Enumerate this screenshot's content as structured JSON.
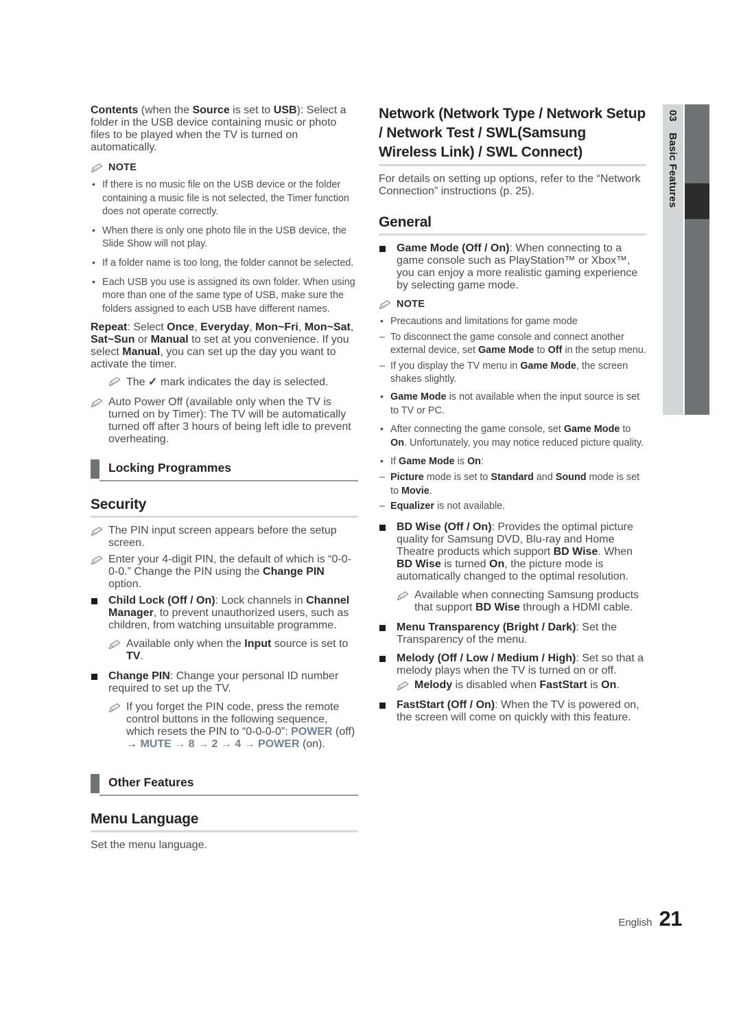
{
  "side_tab": {
    "chapter_number": "03",
    "chapter_label": "Basic Features"
  },
  "footer": {
    "language": "English",
    "page_number": "21"
  },
  "left_column": {
    "contents_paragraph": {
      "lead": "Contents",
      "rest": " (when the ",
      "b1": "Source",
      "mid": " is set to ",
      "b2": "USB",
      "tail": "): Select a folder in the USB device containing music or photo files to be played when the TV is turned on automatically."
    },
    "note_label": "NOTE",
    "note_bullets": [
      "If there is no music file on the USB device or the folder containing a music file is not selected, the Timer function does not operate correctly.",
      "When there is only one photo file in the USB device, the Slide Show will not play.",
      "If a folder name is too long, the folder cannot be selected.",
      "Each USB you use is assigned its own folder. When using more than one of the same type of USB, make sure the folders assigned to each USB have different names."
    ],
    "repeat_paragraph": {
      "lead": "Repeat",
      "t1": ": Select ",
      "b1": "Once",
      "t2": ", ",
      "b2": "Everyday",
      "t3": ", ",
      "b3": "Mon~Fri",
      "t4": ", ",
      "b4": "Mon~Sat",
      "t5": ", ",
      "b5": "Sat~Sun",
      "t6": " or ",
      "b6": "Manual",
      "t7": " to set at you convenience. If you select ",
      "b7": "Manual",
      "t8": ", you can set up the day you want to activate the timer."
    },
    "repeat_note": {
      "pre": "The ",
      "mark": "✓",
      "post": " mark indicates the day is selected."
    },
    "auto_power_note": "Auto Power Off (available only when the TV is turned on by Timer): The TV will be automatically turned off after 3 hours of being left idle to prevent overheating.",
    "section_locking": "Locking Programmes",
    "heading_security": "Security",
    "security_note_1": "The PIN input screen appears before the setup screen.",
    "security_note_2": {
      "t1": "Enter your 4-digit PIN, the default of which is “0-0-0-0.” Change the PIN using the ",
      "b1": "Change PIN",
      "t2": " option."
    },
    "child_lock": {
      "lead": "Child Lock (Off / On)",
      "t1": ": Lock channels in ",
      "b1": "Channel Manager",
      "t2": ", to prevent unauthorized users, such as children, from watching unsuitable programme."
    },
    "child_lock_note": {
      "t1": "Available only when the ",
      "b1": "Input",
      "t2": " source is set to ",
      "b2": "TV",
      "t3": "."
    },
    "change_pin": {
      "lead": "Change PIN",
      "t1": ": Change your personal ID number required to set up the TV."
    },
    "change_pin_note": {
      "t1": "If you forget the PIN code, press the remote control buttons in the following sequence, which resets the PIN to “0-0-0-0”: ",
      "k1": "POWER",
      "t2": " (off) → ",
      "k2": "MUTE",
      "t3": " → 8 → 2 → 4 → ",
      "k3": "POWER",
      "t4": " (on)."
    },
    "section_other_features": "Other Features",
    "heading_menu_language": "Menu Language",
    "menu_language_text": "Set the menu language."
  },
  "right_column": {
    "heading_network": "Network (Network Type / Network Setup / Network Test  / SWL(Samsung Wireless Link) / SWL Connect)",
    "network_text": "For details on setting up options, refer to the “Network Connection” instructions (p. 25).",
    "heading_general": "General",
    "game_mode": {
      "lead": "Game Mode (Off / On)",
      "t1": ": When connecting to a game console such as PlayStation™ or Xbox™, you can enjoy a more realistic gaming experience by selecting game mode."
    },
    "note_label": "NOTE",
    "note_bullet_1": "Precautions and limitations for game mode",
    "note_dashes": [
      {
        "t1": "To disconnect the game console and connect another external device, set ",
        "b1": "Game Mode",
        "t2": " to ",
        "b2": "Off",
        "t3": " in the setup menu."
      },
      {
        "t1": "If you display the TV menu in ",
        "b1": "Game Mode",
        "t2": ", the screen shakes slightly.",
        "b2": "",
        "t3": ""
      }
    ],
    "note_bullet_2": {
      "b1": "Game Mode",
      "t1": " is not available when the input source is set to TV or PC."
    },
    "note_bullet_3": {
      "t1": "After connecting the game console, set ",
      "b1": "Game Mode",
      "t2": " to ",
      "b2": "On",
      "t3": ". Unfortunately, you may notice reduced picture quality."
    },
    "note_bullet_4": {
      "t1": "If ",
      "b1": "Game Mode",
      "t2": " is ",
      "b2": "On",
      "t3": ":"
    },
    "note_bullet_4_dashes": [
      {
        "b1": "Picture",
        "t1": " mode is set to ",
        "b2": "Standard",
        "t2": " and ",
        "b3": "Sound",
        "t3": " mode is set to ",
        "b4": "Movie",
        "t4": "."
      },
      {
        "b1": "Equalizer",
        "t1": " is not available.",
        "b2": "",
        "t2": "",
        "b3": "",
        "t3": "",
        "b4": "",
        "t4": ""
      }
    ],
    "bd_wise": {
      "lead": "BD Wise (Off / On)",
      "t1": ": Provides the optimal picture quality for Samsung DVD, Blu-ray and Home Theatre products which support ",
      "b1": "BD Wise",
      "t2": ". When ",
      "b2": "BD Wise",
      "t3": " is turned ",
      "b3": "On",
      "t4": ", the picture mode is automatically changed to the optimal resolution."
    },
    "bd_wise_note": {
      "t1": "Available when connecting Samsung products that support ",
      "b1": "BD Wise",
      "t2": " through a HDMI cable."
    },
    "menu_transparency": {
      "lead": "Menu Transparency (Bright / Dark)",
      "t1": ": Set the Transparency of the menu."
    },
    "melody": {
      "lead": "Melody (Off / Low / Medium / High)",
      "t1": ": Set so that a melody plays when the TV is turned on or off."
    },
    "melody_note": {
      "b1": "Melody",
      "t1": " is disabled when ",
      "b2": "FastStart",
      "t2": " is ",
      "b3": "On",
      "t3": "."
    },
    "faststart": {
      "lead": "FastStart (Off / On)",
      "t1": ": When the TV is powered on, the screen will come on quickly with this feature."
    }
  }
}
